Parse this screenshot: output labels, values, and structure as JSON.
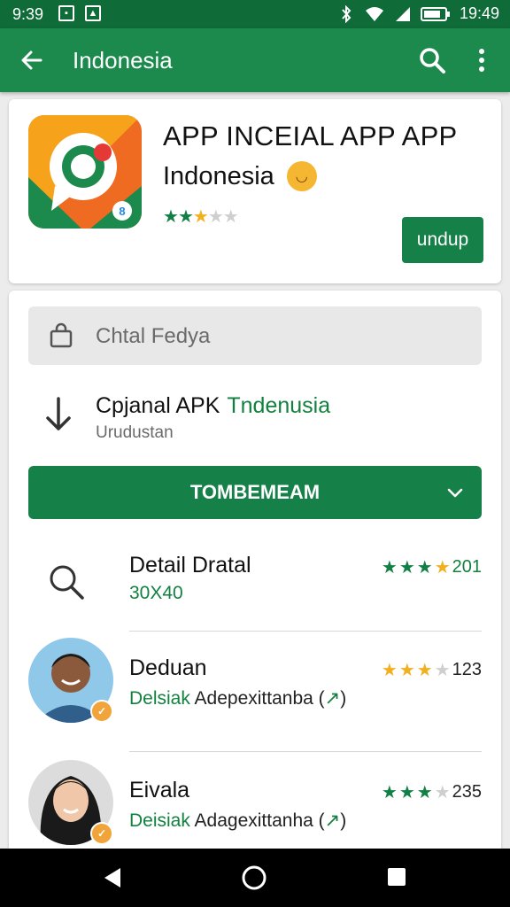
{
  "status_bar": {
    "time": "9:39",
    "clock_right": "19:49",
    "left_icons": [
      "notification-icon",
      "photo-icon"
    ],
    "right_icons": [
      "bluetooth-icon",
      "wifi-icon",
      "signal-icon",
      "battery-icon"
    ]
  },
  "app_bar": {
    "title": "Indonesia",
    "icons": [
      "back-arrow-icon",
      "search-icon",
      "more-vert-icon"
    ]
  },
  "app_header": {
    "title": "APP INCEIAL APP APP",
    "subtitle": "Indonesia",
    "emoji_icon": "smiley-face-icon",
    "rating_stars": {
      "filled": 2.5,
      "total": 5
    },
    "install_button_label": "undup"
  },
  "search": {
    "placeholder": "Chtal Fedya",
    "icon": "shopping-bag-icon"
  },
  "download_row": {
    "title": "Cpjanal APK",
    "title_highlight": "Tndenusia",
    "subtitle": "Urudustan",
    "icon": "download-arrow-icon"
  },
  "primary_button": {
    "label": "TOMBEMEAM",
    "icon": "chevron-down-icon"
  },
  "list": [
    {
      "name": "Detail Dratal",
      "sub_green": "30X40",
      "sub_text": "",
      "rating_value": "201",
      "stars_filled": 4,
      "star_color": "green",
      "icon": "search-icon"
    },
    {
      "name": "Deduan",
      "sub_green": "Delsiak",
      "sub_text": "Adepexittanba",
      "rating_value": "123",
      "stars_filled": 3,
      "star_color": "yellow",
      "icon": "avatar-man"
    },
    {
      "name": "Eivala",
      "sub_green": "Deisiak",
      "sub_text": "Adagexittanha",
      "rating_value": "235",
      "stars_filled": 3,
      "star_color": "green",
      "icon": "avatar-woman"
    }
  ],
  "colors": {
    "status_bar": "#0f6b38",
    "app_bar": "#1d8a4d",
    "primary": "#168049",
    "star_green": "#128045",
    "star_yellow": "#f2b01e"
  },
  "nav_bar": {
    "icons": [
      "nav-back-icon",
      "nav-home-icon",
      "nav-recents-icon"
    ]
  }
}
